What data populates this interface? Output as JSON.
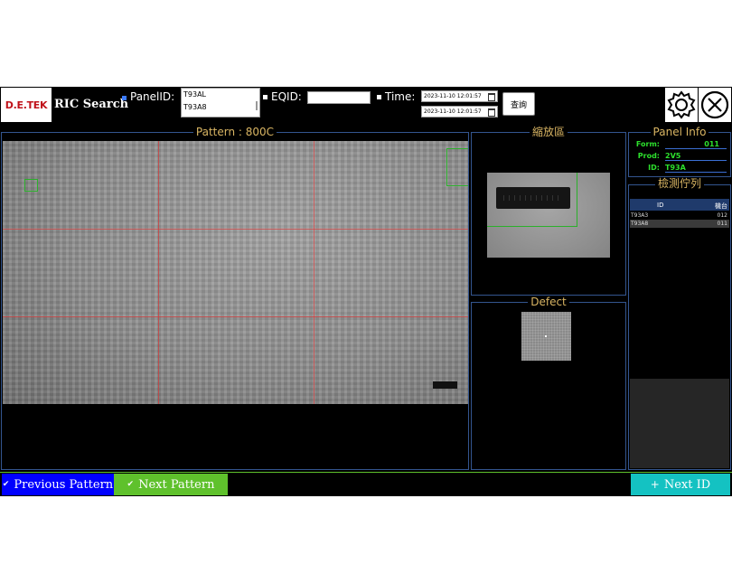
{
  "header": {
    "logo_text": "D.E.TEK",
    "title": "RIC Search",
    "panel_id_label": "PanelID:",
    "panel_ids": [
      "T93AL",
      "T93A8"
    ],
    "eqid_label": "EQID:",
    "eqid_value": "",
    "time_label": "Time:",
    "time_from": "2023-11-10 12:01:57",
    "time_to": "2023-11-10 12:01:57",
    "query_button": "查詢"
  },
  "pattern_panel": {
    "title": "Pattern : 800C"
  },
  "zoom_panel": {
    "title": "縮放區"
  },
  "defect_panel": {
    "title": "Defect"
  },
  "panel_info": {
    "title": "Panel Info",
    "rows": [
      {
        "label": "Form:",
        "value": "011"
      },
      {
        "label": "Prod:",
        "value": "2V5"
      },
      {
        "label": "ID:",
        "value": "T93A"
      }
    ]
  },
  "queue": {
    "title": "檢測佇列",
    "headers": [
      "ID",
      "機台"
    ],
    "rows": [
      {
        "id": "T93A3",
        "machine": "012"
      },
      {
        "id": "T93A8",
        "machine": "011"
      }
    ]
  },
  "bottom_bar": {
    "prev_label": "Previous Pattern",
    "next_label": "Next Pattern",
    "next_id_label": "Next ID"
  },
  "colors": {
    "accent_blue": "#0000ff",
    "next_green": "#5fc12c",
    "next_id_teal": "#14c2c2",
    "panel_border": "#33558f",
    "title_gold": "#d9b563"
  }
}
